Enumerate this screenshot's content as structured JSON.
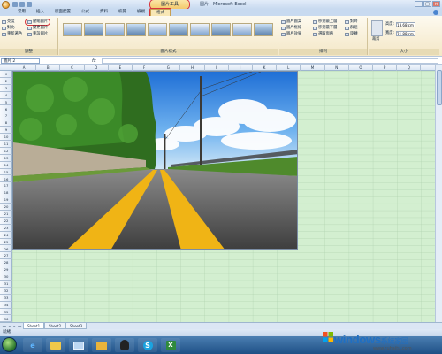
{
  "window": {
    "title": "圖片 - Microsoft Excel",
    "context_group": "圖片工具"
  },
  "ribbon": {
    "tabs": [
      "常用",
      "插入",
      "版面配置",
      "公式",
      "資料",
      "校閱",
      "檢視",
      "格式"
    ],
    "active_tab": "格式",
    "adjust_group": {
      "label": "調整",
      "commands": [
        "亮度",
        "對比",
        "重新著色",
        "壓縮圖片",
        "變更圖片",
        "重設圖片"
      ],
      "highlighted": "壓縮圖片"
    },
    "styles_group": {
      "label": "圖片樣式",
      "thumb_count": 10
    },
    "right_group": {
      "shape_cmds": [
        "圖片圖案",
        "圖片框線",
        "圖片效果"
      ],
      "arrange_cmds": [
        "移到最上層",
        "移到最下層",
        "選取窗格"
      ],
      "align_cmds": [
        "對齊",
        "群組",
        "旋轉"
      ],
      "arrange_label": "排列",
      "crop_label": "裁剪",
      "height_label": "高度:",
      "height_value": "13.68 cm",
      "width_label": "寬度:",
      "width_value": "21.88 cm",
      "size_label": "大小"
    }
  },
  "formula_bar": {
    "name_box": "圖片 2",
    "fx": "fx",
    "value": ""
  },
  "grid": {
    "columns": [
      "A",
      "B",
      "C",
      "D",
      "E",
      "F",
      "G",
      "H",
      "I",
      "J",
      "K",
      "L",
      "M",
      "N",
      "O",
      "P",
      "Q"
    ],
    "rows": [
      "1",
      "2",
      "3",
      "4",
      "5",
      "6",
      "7",
      "8",
      "9",
      "10",
      "11",
      "12",
      "13",
      "14",
      "15",
      "16",
      "17",
      "18",
      "19",
      "20",
      "21",
      "22",
      "23",
      "24",
      "25",
      "26",
      "27",
      "28",
      "29",
      "30",
      "31",
      "32",
      "33",
      "34",
      "35",
      "36"
    ]
  },
  "sheets": {
    "tabs": [
      "Sheet1",
      "Sheet2",
      "Sheet3"
    ],
    "active": "Sheet1",
    "nav": [
      "◂◂",
      "◂",
      "▸",
      "▸▸"
    ]
  },
  "status_bar": {
    "text": "就緒"
  },
  "watermark": {
    "brand": "windows",
    "brand_cn": "系统家园",
    "site": "www.ruhaitu.com"
  },
  "colors": {
    "ribbon_context": "#f3c96d",
    "grid_green": "#d3efd0",
    "highlight_red": "#d8343b",
    "taskbar": "#1e4f85"
  }
}
